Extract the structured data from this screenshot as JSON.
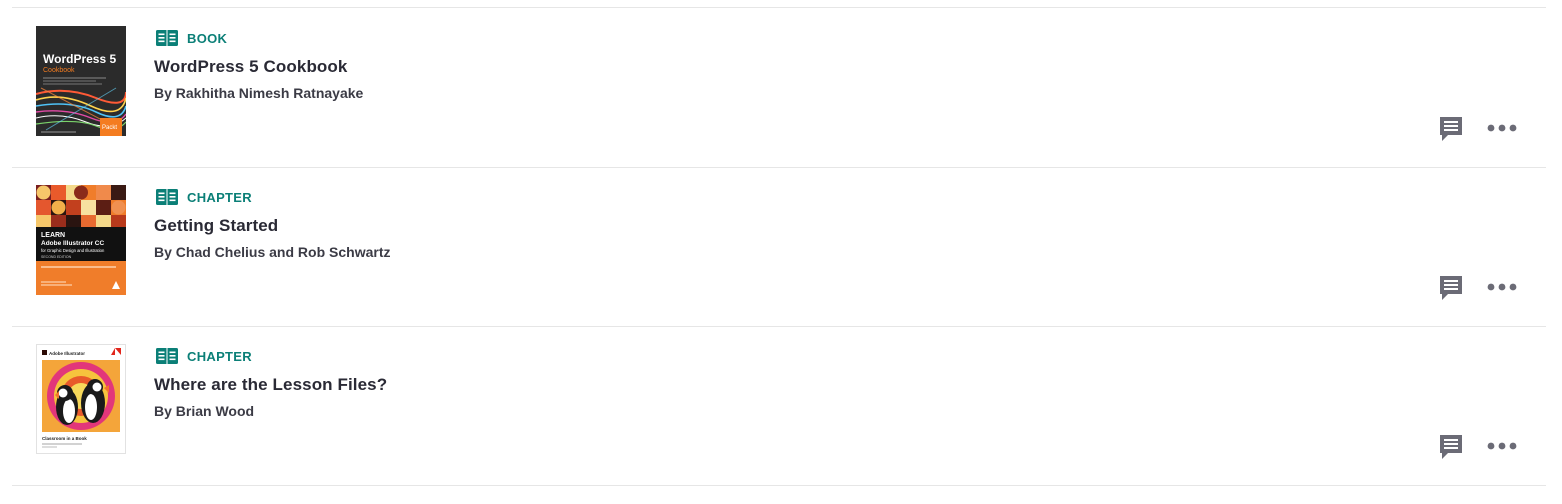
{
  "results": [
    {
      "type_label": "BOOK",
      "title": "WordPress 5 Cookbook",
      "author": "By Rakhitha Nimesh Ratnayake",
      "cover": {
        "title_line1": "WordPress 5",
        "title_line2": "Cookbook",
        "publisher": "Packt",
        "bg": "#2b2b2b",
        "accent": "#f47c20"
      }
    },
    {
      "type_label": "CHAPTER",
      "title": "Getting Started",
      "author": "By Chad Chelius and Rob Schwartz",
      "cover": {
        "title_line1": "LEARN",
        "title_line2": "Adobe Illustrator CC",
        "title_line3": "for Graphic Design and Illustration",
        "edition": "SECOND EDITION",
        "bg": "#f07d2a"
      }
    },
    {
      "type_label": "CHAPTER",
      "title": "Where are the Lesson Files?",
      "author": "By Brian Wood",
      "cover": {
        "brand": "Adobe Illustrator",
        "series": "Classroom in a Book",
        "bg": "#ffffff"
      }
    }
  ],
  "icons": {
    "type_icon": "open-book-icon",
    "note_icon": "note-icon",
    "more_icon": "more-horizontal-icon"
  },
  "colors": {
    "accent": "#0b7f77",
    "icon_gray": "#6b6b76",
    "divider": "#e6e6e6"
  }
}
